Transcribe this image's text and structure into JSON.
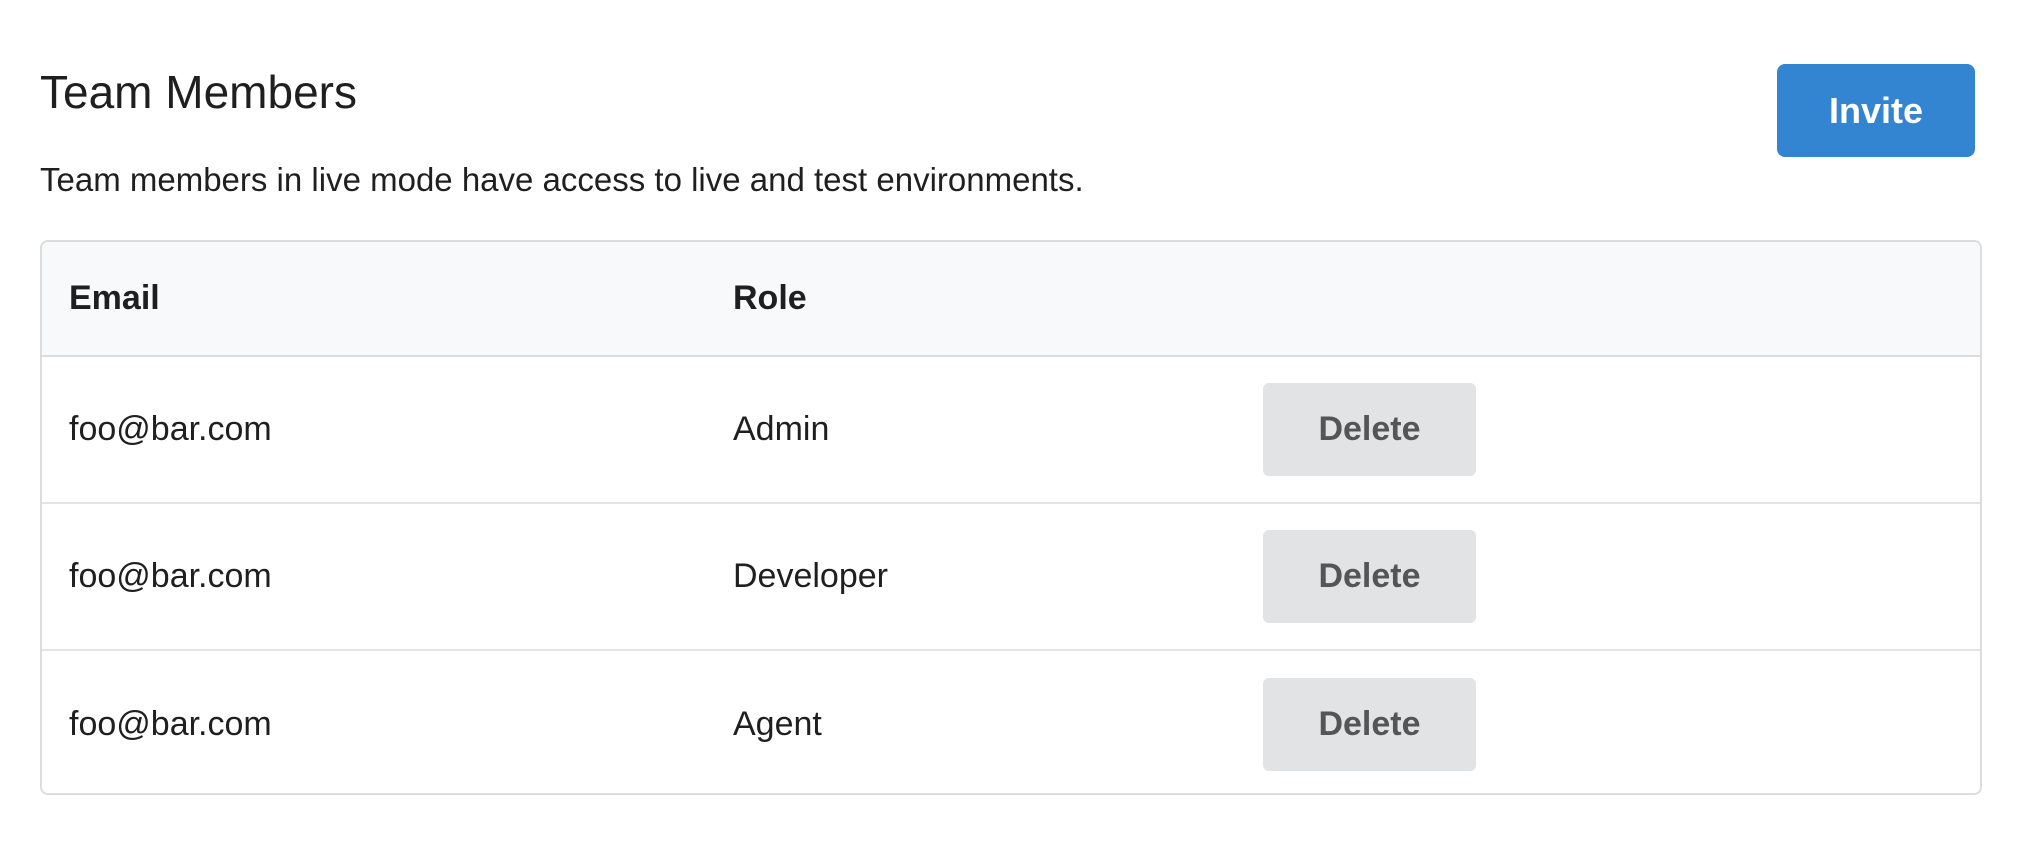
{
  "header": {
    "title": "Team Members",
    "invite_label": "Invite",
    "description": "Team members in live mode have access to live and test environments."
  },
  "table": {
    "columns": {
      "email": "Email",
      "role": "Role",
      "actions": ""
    },
    "rows": [
      {
        "email": "foo@bar.com",
        "role": "Admin",
        "action_label": "Delete"
      },
      {
        "email": "foo@bar.com",
        "role": "Developer",
        "action_label": "Delete"
      },
      {
        "email": "foo@bar.com",
        "role": "Agent",
        "action_label": "Delete"
      }
    ]
  },
  "colors": {
    "primary_button": "#3385d1",
    "secondary_button": "#e2e3e4",
    "header_background": "#f8f9fa",
    "border": "#dcdcdc"
  }
}
